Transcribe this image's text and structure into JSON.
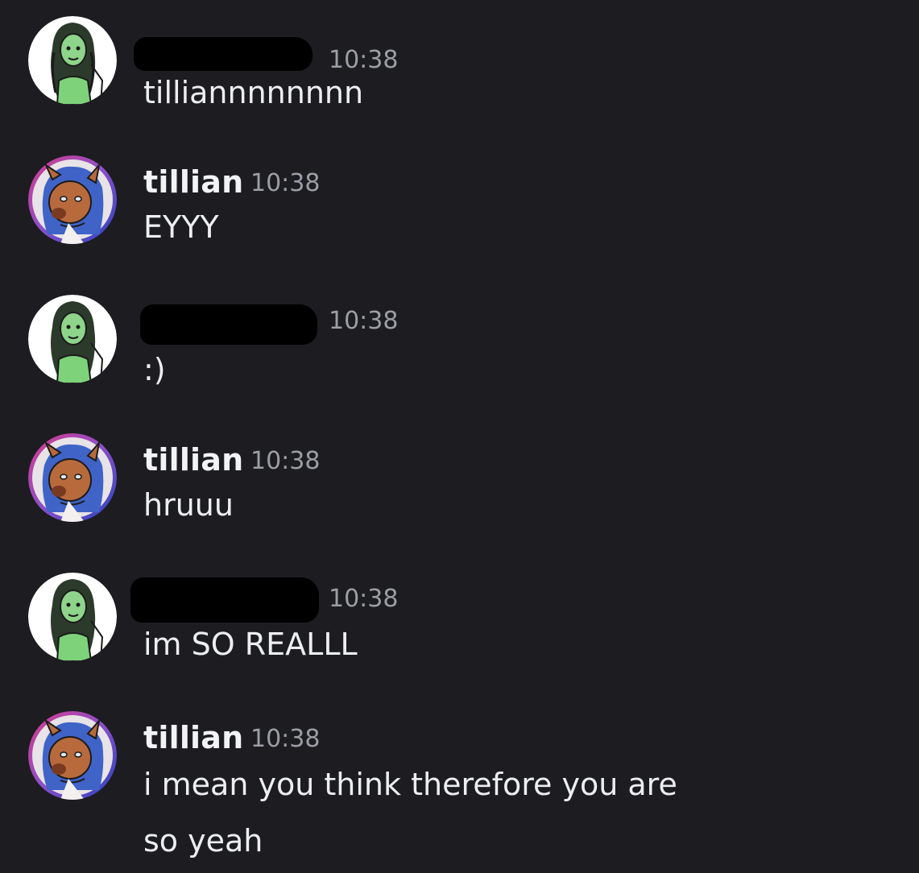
{
  "messages": [
    {
      "author": "",
      "author_redacted": true,
      "avatar": "green-character-avatar",
      "time": "10:38",
      "lines": [
        "tilliannnnnnnn"
      ]
    },
    {
      "author": "tillian",
      "author_redacted": false,
      "avatar": "fox-character-avatar",
      "time": "10:38",
      "lines": [
        "EYYY"
      ]
    },
    {
      "author": "",
      "author_redacted": true,
      "avatar": "green-character-avatar",
      "time": "10:38",
      "lines": [
        ":)"
      ]
    },
    {
      "author": "tillian",
      "author_redacted": false,
      "avatar": "fox-character-avatar",
      "time": "10:38",
      "lines": [
        "hruuu"
      ]
    },
    {
      "author": "",
      "author_redacted": true,
      "avatar": "green-character-avatar",
      "time": "10:38",
      "lines": [
        "im SO REALLL"
      ]
    },
    {
      "author": "tillian",
      "author_redacted": false,
      "avatar": "fox-character-avatar",
      "time": "10:38",
      "lines": [
        "i mean you think therefore you are",
        "so yeah"
      ]
    }
  ],
  "colors": {
    "background": "#1c1c21",
    "text": "#eceef2",
    "timestamp": "#9c9ea6",
    "green_avatar_accent": "#7ed37a",
    "fox_avatar_fur": "#b86a3c",
    "fox_avatar_hair": "#3f63c7"
  }
}
